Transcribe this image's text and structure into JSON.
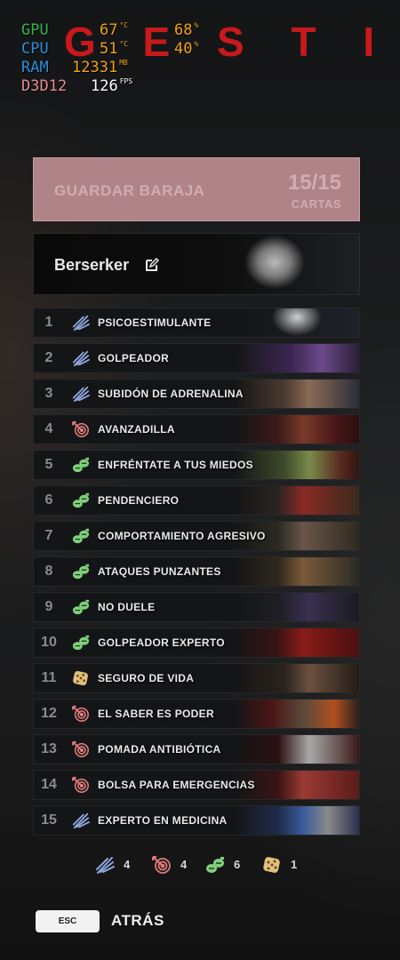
{
  "page_title": "G E S T I Ó N D E",
  "overlay": {
    "rows": [
      {
        "label": "GPU",
        "v1": "67",
        "u1": "°C",
        "v2": "68",
        "u2": "%"
      },
      {
        "label": "CPU",
        "v1": "51",
        "u1": "°C",
        "v2": "40",
        "u2": "%"
      },
      {
        "label": "RAM",
        "v1": "12331",
        "u1": "MB"
      },
      {
        "label": "D3D12",
        "v1": "126",
        "u1": "FPS"
      }
    ]
  },
  "save_button": {
    "label": "GUARDAR BARAJA",
    "count": "15/15",
    "count_label": "CARTAS"
  },
  "deck": {
    "name": "Berserker"
  },
  "cards": [
    {
      "number": "1",
      "name": "PSICOESTIMULANTE",
      "type": "wing"
    },
    {
      "number": "2",
      "name": "GOLPEADOR",
      "type": "wing"
    },
    {
      "number": "3",
      "name": "SUBIDÓN DE ADRENALINA",
      "type": "wing"
    },
    {
      "number": "4",
      "name": "AVANZADILLA",
      "type": "target"
    },
    {
      "number": "5",
      "name": "ENFRÉNTATE A TUS MIEDOS",
      "type": "grenade"
    },
    {
      "number": "6",
      "name": "PENDENCIERO",
      "type": "grenade"
    },
    {
      "number": "7",
      "name": "COMPORTAMIENTO AGRESIVO",
      "type": "grenade"
    },
    {
      "number": "8",
      "name": "ATAQUES PUNZANTES",
      "type": "grenade"
    },
    {
      "number": "9",
      "name": "NO DUELE",
      "type": "grenade"
    },
    {
      "number": "10",
      "name": "GOLPEADOR EXPERTO",
      "type": "grenade"
    },
    {
      "number": "11",
      "name": "SEGURO DE VIDA",
      "type": "die"
    },
    {
      "number": "12",
      "name": "EL SABER ES PODER",
      "type": "target"
    },
    {
      "number": "13",
      "name": "POMADA ANTIBIÓTICA",
      "type": "target"
    },
    {
      "number": "14",
      "name": "BOLSA PARA EMERGENCIAS",
      "type": "target"
    },
    {
      "number": "15",
      "name": "EXPERTO EN MEDICINA",
      "type": "wing"
    }
  ],
  "summary": [
    {
      "type": "wing",
      "count": "4"
    },
    {
      "type": "target",
      "count": "4"
    },
    {
      "type": "grenade",
      "count": "6"
    },
    {
      "type": "die",
      "count": "1"
    }
  ],
  "footer": {
    "key": "ESC",
    "label": "ATRÁS"
  },
  "icons": {
    "wing": "wing-icon",
    "target": "target-icon",
    "grenade": "grenade-icon",
    "die": "die-icon",
    "edit": "edit-icon"
  },
  "colors": {
    "title": "#c8191c",
    "save_button": "#b08389",
    "wing": "#8fa8e0",
    "target": "#e07a7a",
    "grenade": "#7fd07a",
    "die": "#e0c07a",
    "overlay_green": "#35b54a",
    "overlay_blue": "#2a8fdc",
    "overlay_orange": "#f0a21a",
    "overlay_pink": "#e88b95"
  }
}
